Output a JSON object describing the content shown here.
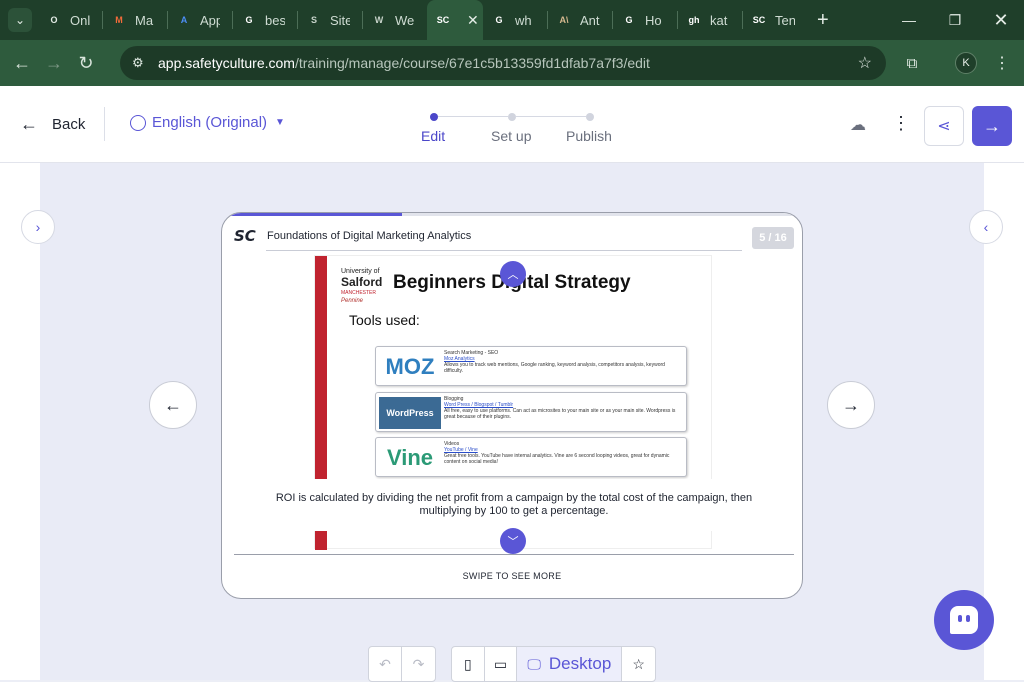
{
  "browser": {
    "tabs": [
      {
        "label": "Onl",
        "favicon": "O",
        "color": "#e4ece6"
      },
      {
        "label": "Ma",
        "favicon": "M",
        "color": "#f26b3a"
      },
      {
        "label": "App",
        "favicon": "A",
        "color": "#4d8ef7"
      },
      {
        "label": "bes",
        "favicon": "G",
        "color": "#ffffff"
      },
      {
        "label": "Site",
        "favicon": "S",
        "color": "#c7d3ca"
      },
      {
        "label": "We",
        "favicon": "W",
        "color": "#c7d3ca"
      },
      {
        "label": "SC",
        "favicon": "SC",
        "color": "#ffffff",
        "active": true
      },
      {
        "label": "wh",
        "favicon": "G",
        "color": "#ffffff"
      },
      {
        "label": "Ant",
        "favicon": "A\\",
        "color": "#d6b98f"
      },
      {
        "label": "Ho",
        "favicon": "G",
        "color": "#ffffff"
      },
      {
        "label": "kat",
        "favicon": "gh",
        "color": "#ffffff"
      },
      {
        "label": "Ten",
        "favicon": "SC",
        "color": "#ffffff"
      }
    ],
    "url_host": "app.safetyculture.com",
    "url_path": "/training/manage/course/67e1c5b13359fd1dfab7a7f3/edit",
    "profile_initial": "K"
  },
  "header": {
    "back_label": "Back",
    "language": "English (Original)",
    "steps": [
      "Edit",
      "Set up",
      "Publish"
    ],
    "current_step": 0
  },
  "card": {
    "course_title": "Foundations of Digital Marketing Analytics",
    "pager": "5 / 16",
    "progress": 0.31,
    "caption": "ROI is calculated by dividing the net profit from a campaign by the total cost of the campaign, then multiplying by 100 to get a percentage.",
    "swipe_hint": "SWIPE TO SEE MORE"
  },
  "slide": {
    "uni_top": "University of",
    "uni_name": "Salford",
    "uni_city": "MANCHESTER",
    "uni_partner": "Pennine",
    "title": "Beginners Digital Strategy",
    "subtitle": "Tools used:",
    "tools": [
      {
        "logo": "MOZ",
        "logo_color": "#2f7fbf",
        "heading": "Search Marketing - SEO",
        "link": "Moz Analytics",
        "desc": "Allows you to track web mentions, Google ranking, keyword analysis, competitors analysis, keyword difficulty."
      },
      {
        "logo": "WordPress",
        "logo_color": "#3b6a94",
        "heading": "Blogging",
        "link": "Word Press / Blogspot / Tumblr",
        "desc": "All free, easy to use platforms. Can act as microsites to your main site or as your main site. Wordpress is great because of their plugins."
      },
      {
        "logo": "Vine",
        "logo_color": "#2b9a76",
        "heading": "Videos",
        "link": "YouTube / Vine",
        "desc": "Great free tools. YouTube have internal analytics. Vine are 6 second looping videos, great for dynamic content on social media!"
      }
    ]
  },
  "bottombar": {
    "desktop_label": "Desktop"
  }
}
